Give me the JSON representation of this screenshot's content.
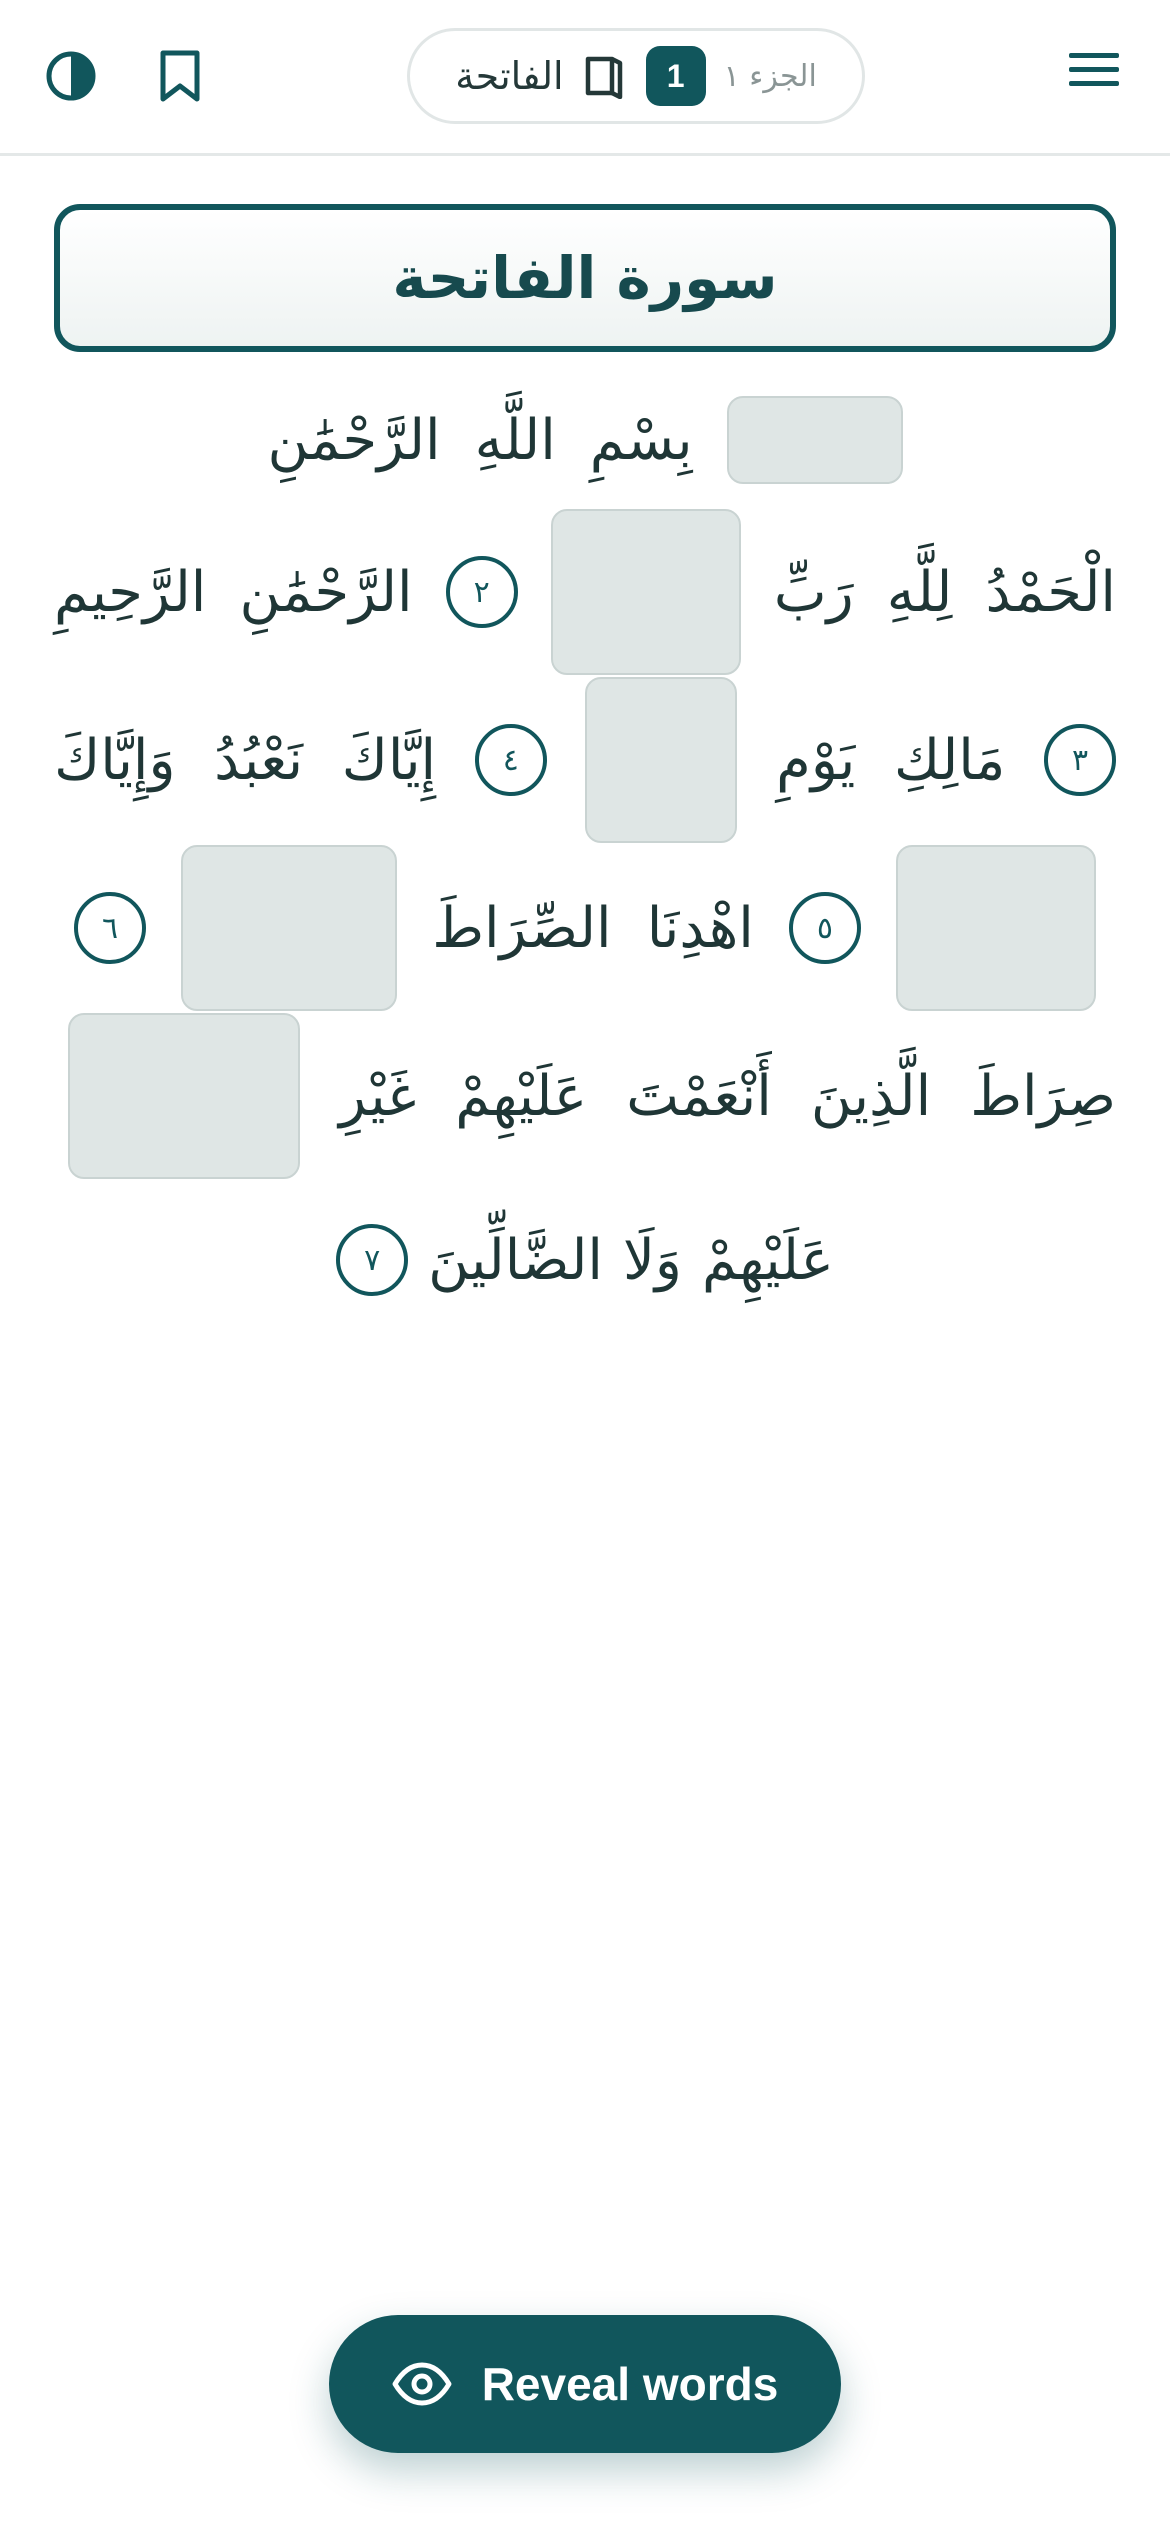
{
  "header": {
    "surah_name": "الفاتحة",
    "page_number": "1",
    "juz_label": "الجزء ١",
    "icons": {
      "theme": "contrast-icon",
      "bookmark": "bookmark-icon",
      "book": "book-open-icon",
      "menu": "hamburger-menu-icon"
    }
  },
  "title": "سورة الفاتحة",
  "lines": [
    {
      "words": [
        "بِسْمِ",
        "اللَّهِ",
        "الرَّحْمَٰنِ"
      ]
    },
    {
      "words": [
        "الْحَمْدُ",
        "لِلَّهِ",
        "رَبِّ",
        "الرَّحْمَٰنِ",
        "الرَّحِيمِ"
      ],
      "markers": [
        "٢"
      ]
    },
    {
      "words": [
        "مَالِكِ",
        "يَوْمِ",
        "إِيَّاكَ",
        "نَعْبُدُ",
        "وَإِيَّاكَ"
      ],
      "markers": [
        "٣",
        "٤"
      ]
    },
    {
      "words": [
        "اهْدِنَا",
        "الصِّرَاطَ"
      ],
      "markers": [
        "٥",
        "٦"
      ]
    },
    {
      "words": [
        "صِرَاطَ",
        "الَّذِينَ",
        "أَنْعَمْتَ",
        "عَلَيْهِمْ",
        "غَيْرِ"
      ]
    },
    {
      "words": [
        "عَلَيْهِمْ",
        "وَلَا",
        "الضَّالِّينَ"
      ],
      "markers": [
        "٧"
      ]
    }
  ],
  "reveal_button": {
    "label": "Reveal words",
    "icon": "eye-icon"
  },
  "colors": {
    "accent": "#11565c",
    "hidden_word_fill": "#dfe6e5",
    "text": "#1f3636"
  }
}
